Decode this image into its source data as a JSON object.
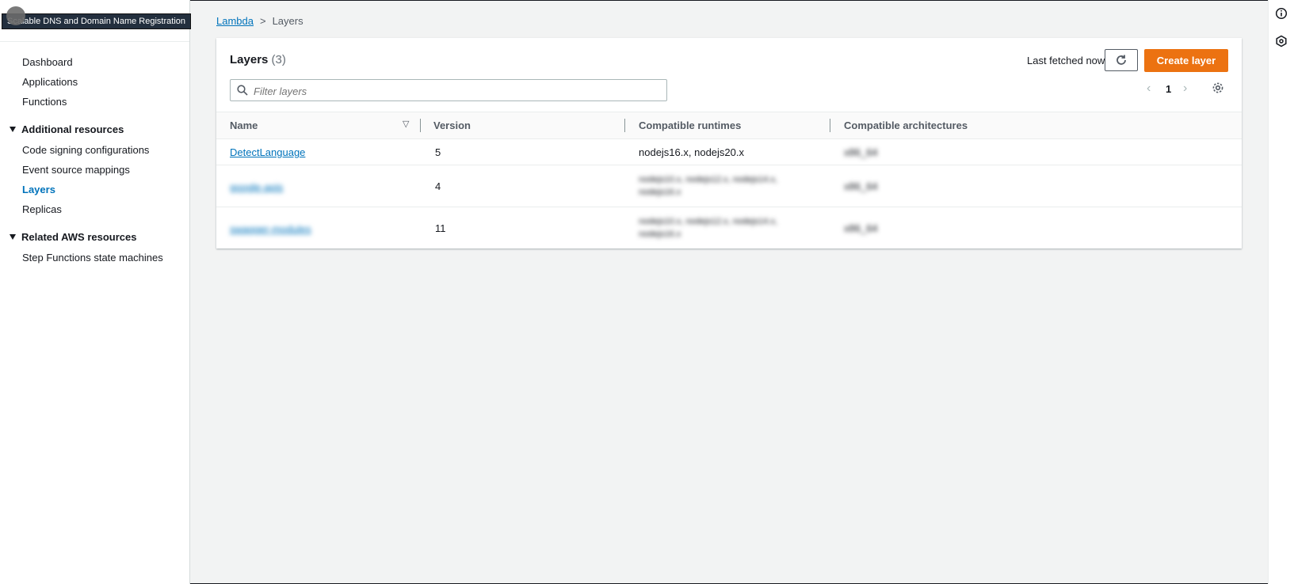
{
  "tooltip": "Scalable DNS and Domain Name Registration",
  "sidebar": {
    "items": [
      {
        "label": "Dashboard"
      },
      {
        "label": "Applications"
      },
      {
        "label": "Functions"
      }
    ],
    "additional_resources": {
      "title": "Additional resources",
      "items": [
        {
          "label": "Code signing configurations"
        },
        {
          "label": "Event source mappings"
        },
        {
          "label": "Layers",
          "active": true
        },
        {
          "label": "Replicas"
        }
      ]
    },
    "related": {
      "title": "Related AWS resources",
      "items": [
        {
          "label": "Step Functions state machines"
        }
      ]
    }
  },
  "breadcrumb": {
    "root": "Lambda",
    "current": "Layers"
  },
  "card": {
    "title": "Layers",
    "count": "(3)",
    "last_fetched": "Last fetched now",
    "create_label": "Create layer",
    "filter_placeholder": "Filter layers",
    "page": "1"
  },
  "table": {
    "headers": [
      "Name",
      "Version",
      "Compatible runtimes",
      "Compatible architectures"
    ],
    "rows": [
      {
        "name": "DetectLanguage",
        "version": "5",
        "runtimes": "nodejs16.x, nodejs20.x",
        "runtimes_2": "",
        "arch": "x86_64"
      },
      {
        "name": "google-apis",
        "version": "4",
        "runtimes": "nodejs10.x, nodejs12.x, nodejs14.x,",
        "runtimes_2": "nodejs16.x",
        "arch": "x86_64"
      },
      {
        "name": "swagger-modules",
        "version": "11",
        "runtimes": "nodejs10.x, nodejs12.x, nodejs14.x,",
        "runtimes_2": "nodejs16.x",
        "arch": "x86_64"
      }
    ]
  },
  "colors": {
    "accent": "#0073bb",
    "primary_button": "#ec7211",
    "background": "#f2f3f3"
  }
}
